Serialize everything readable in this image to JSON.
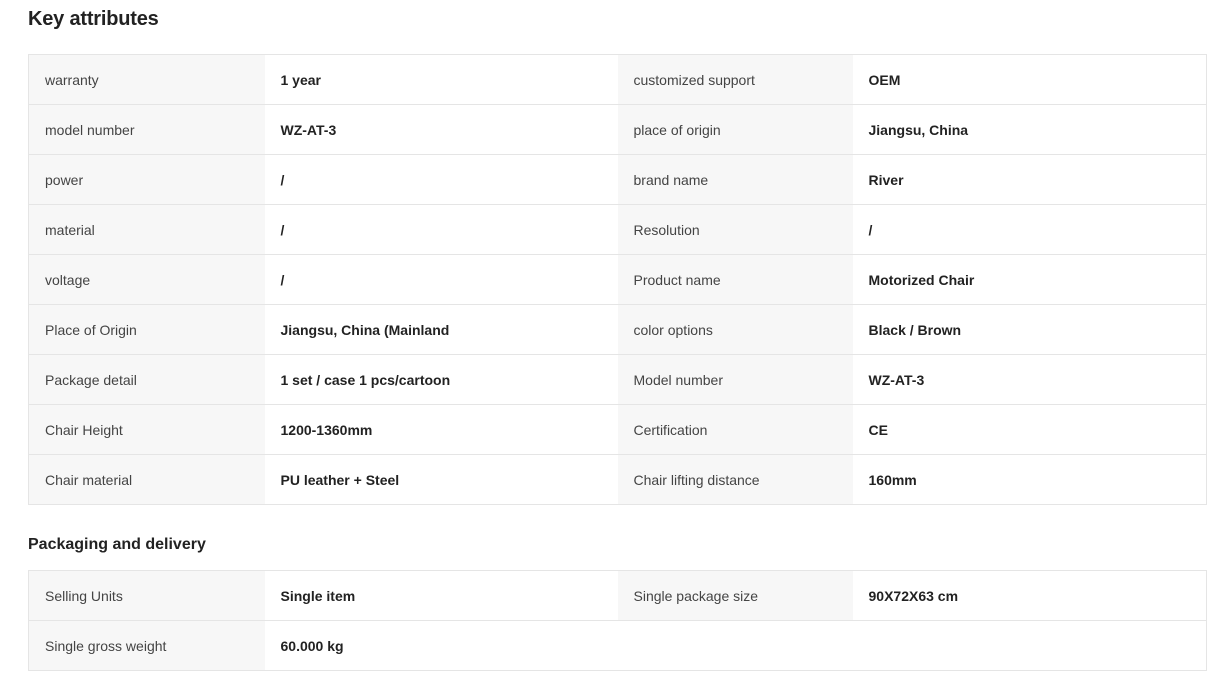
{
  "key_attributes": {
    "title": "Key attributes",
    "rows": [
      [
        {
          "label": "warranty",
          "value": "1 year"
        },
        {
          "label": "customized support",
          "value": "OEM"
        }
      ],
      [
        {
          "label": "model number",
          "value": "WZ-AT-3"
        },
        {
          "label": "place of origin",
          "value": "Jiangsu, China"
        }
      ],
      [
        {
          "label": "power",
          "value": "/"
        },
        {
          "label": "brand name",
          "value": "River"
        }
      ],
      [
        {
          "label": "material",
          "value": "/"
        },
        {
          "label": "Resolution",
          "value": "/"
        }
      ],
      [
        {
          "label": "voltage",
          "value": "/"
        },
        {
          "label": "Product name",
          "value": "Motorized Chair"
        }
      ],
      [
        {
          "label": "Place of Origin",
          "value": "Jiangsu, China (Mainland"
        },
        {
          "label": "color options",
          "value": "Black / Brown"
        }
      ],
      [
        {
          "label": "Package detail",
          "value": "1 set / case 1 pcs/cartoon"
        },
        {
          "label": "Model number",
          "value": "WZ-AT-3"
        }
      ],
      [
        {
          "label": "Chair Height",
          "value": "1200-1360mm"
        },
        {
          "label": "Certification",
          "value": "CE"
        }
      ],
      [
        {
          "label": "Chair material",
          "value": "PU leather + Steel"
        },
        {
          "label": "Chair lifting distance",
          "value": "160mm"
        }
      ]
    ]
  },
  "packaging": {
    "title": "Packaging and delivery",
    "rows": [
      [
        {
          "label": "Selling Units",
          "value": "Single item"
        },
        {
          "label": "Single package size",
          "value": "90X72X63 cm"
        }
      ],
      [
        {
          "label": "Single gross weight",
          "value": "60.000 kg"
        },
        {
          "label": "",
          "value": ""
        }
      ]
    ]
  }
}
